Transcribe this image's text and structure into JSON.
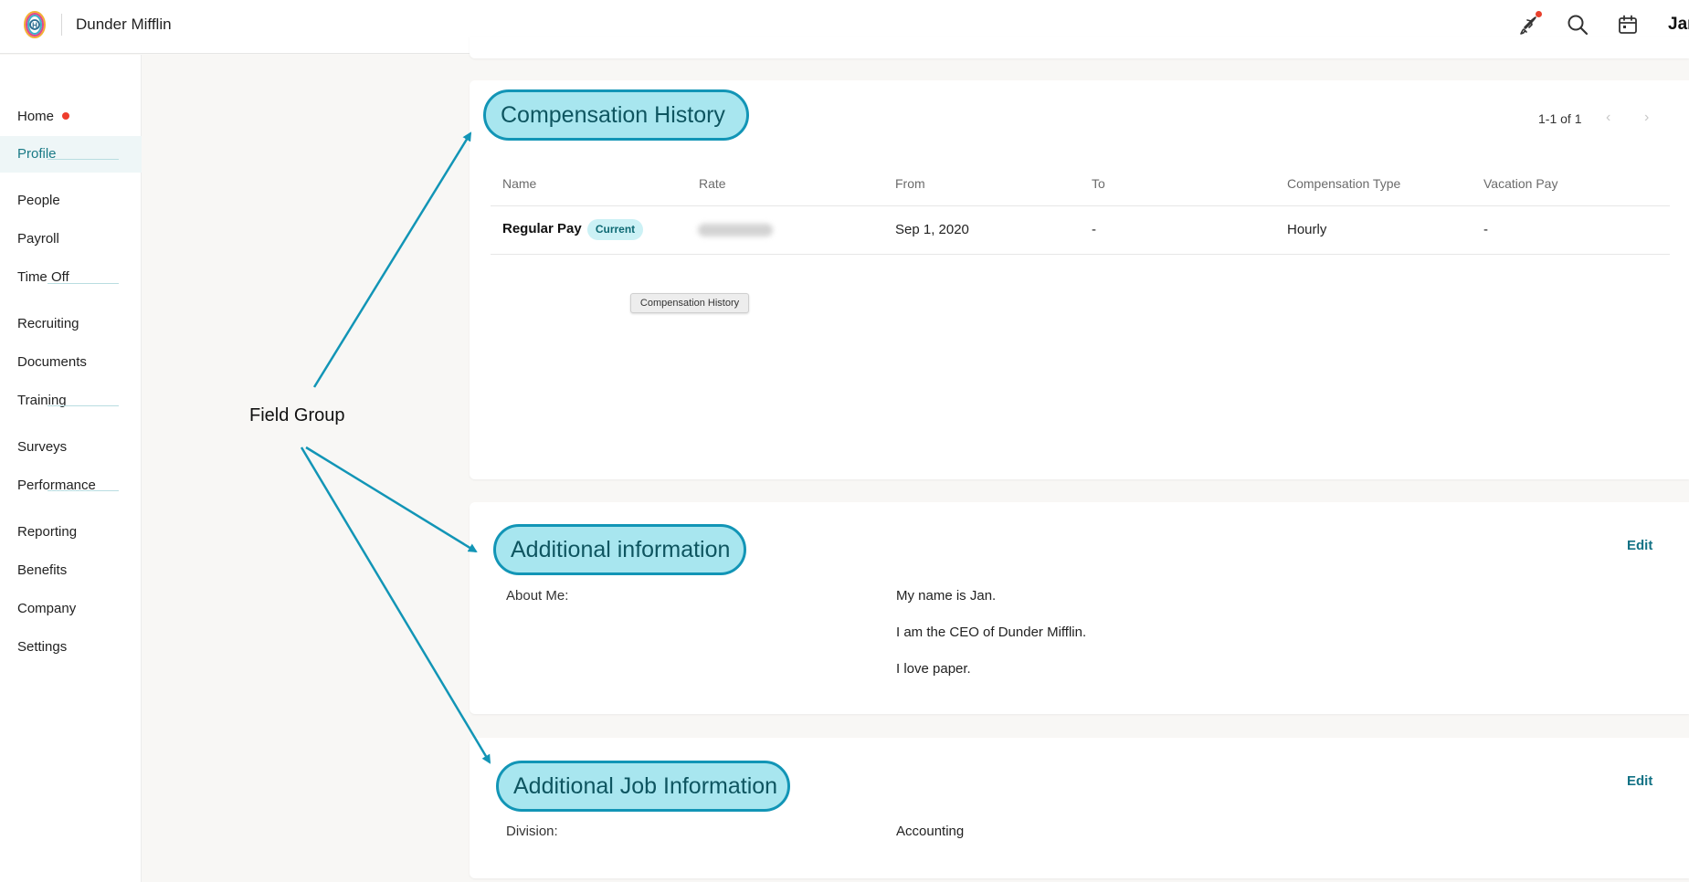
{
  "topbar": {
    "company_name": "Dunder Mifflin",
    "user_name": "Jan",
    "icons": [
      "rocket-icon",
      "search-icon",
      "calendar-icon"
    ]
  },
  "sidebar": {
    "items": [
      {
        "label": "Home",
        "has_dot": true
      },
      {
        "label": "Profile",
        "active": true
      },
      {
        "label": "People"
      },
      {
        "label": "Payroll"
      },
      {
        "label": "Time Off"
      },
      {
        "label": "Recruiting"
      },
      {
        "label": "Documents"
      },
      {
        "label": "Training"
      },
      {
        "label": "Surveys"
      },
      {
        "label": "Performance"
      },
      {
        "label": "Reporting"
      },
      {
        "label": "Benefits"
      },
      {
        "label": "Company"
      },
      {
        "label": "Settings"
      }
    ]
  },
  "compensation": {
    "title": "Compensation History",
    "pager": "1-1 of 1",
    "columns": [
      "Name",
      "Rate",
      "From",
      "To",
      "Compensation Type",
      "Vacation Pay"
    ],
    "rows": [
      {
        "name": "Regular Pay",
        "badge": "Current",
        "rate": "",
        "from": "Sep 1, 2020",
        "to": "-",
        "type": "Hourly",
        "vacation": "-"
      }
    ],
    "tooltip": "Compensation History"
  },
  "additional_info": {
    "title": "Additional information",
    "edit": "Edit",
    "label": "About Me:",
    "lines": [
      "My name is Jan.",
      "I am the CEO of Dunder Mifflin.",
      "I love paper."
    ]
  },
  "job_info": {
    "title": "Additional Job Information",
    "edit": "Edit",
    "label": "Division:",
    "value": "Accounting"
  },
  "annotation": {
    "label": "Field Group",
    "color": "#1295b6"
  },
  "colors": {
    "accent": "#1a7a86",
    "pill_fill": "#a8e6ef",
    "pill_border": "#1295b6",
    "notification": "#e8402d"
  }
}
